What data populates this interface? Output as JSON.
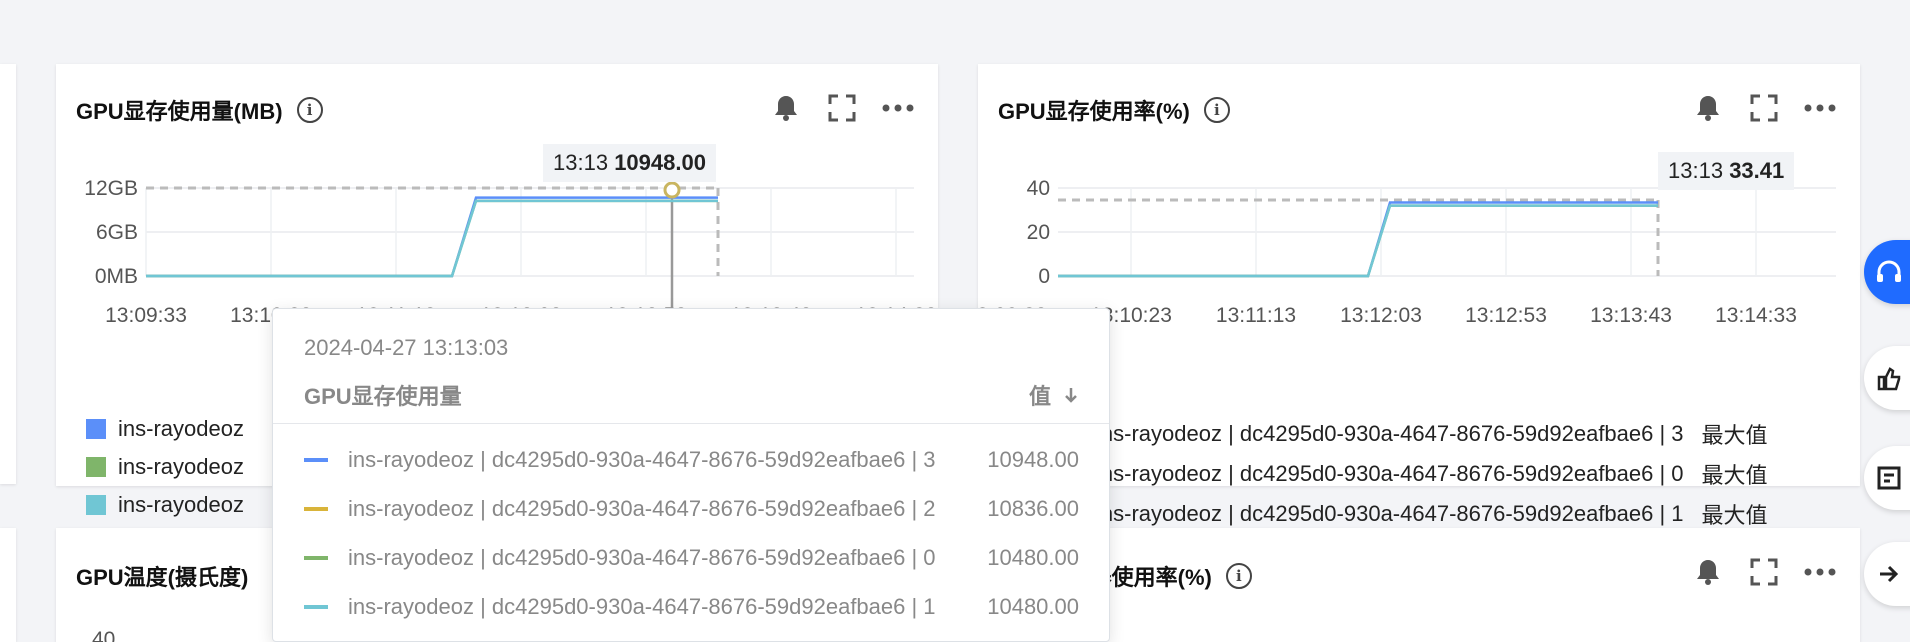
{
  "cards": {
    "memory_used": {
      "title": "GPU显存使用量(MB)",
      "y_ticks": [
        "12GB",
        "6GB",
        "0MB"
      ],
      "x_ticks": [
        "13:09:33",
        "13:10:23",
        "13:11:13",
        "13:12:03",
        "13:12:53",
        "13:13:43",
        "13:14:33"
      ],
      "point_label": {
        "time": "13:13",
        "value": "10948.00"
      },
      "legend": [
        "ins-rayodeoz",
        "ins-rayodeoz",
        "ins-rayodeoz"
      ]
    },
    "memory_rate": {
      "title": "GPU显存使用率(%)",
      "y_ticks": [
        "40",
        "20",
        "0"
      ],
      "x_ticks": [
        "13:09:33",
        "13:10:23",
        "13:11:13",
        "13:12:03",
        "13:12:53",
        "13:13:43",
        "13:14:33"
      ],
      "point_label": {
        "time": "13:13",
        "value": "33.41"
      },
      "legend": [
        {
          "text": "ins-rayodeoz | dc4295d0-930a-4647-8676-59d92eafbae6 | 3",
          "max": "最大值"
        },
        {
          "text": "ins-rayodeoz | dc4295d0-930a-4647-8676-59d92eafbae6 | 0",
          "max": "最大值"
        },
        {
          "text": "ins-rayodeoz | dc4295d0-930a-4647-8676-59d92eafbae6 | 1",
          "max": "最大值"
        }
      ]
    },
    "temperature": {
      "title": "GPU温度(摄氏度)",
      "y_tick": "40"
    },
    "encoder": {
      "title": "GPU编码器使用率(%)"
    }
  },
  "tooltip": {
    "date": "2024-04-27 13:13:03",
    "metric": "GPU显存使用量",
    "value_header": "值",
    "items": [
      {
        "name": "ins-rayodeoz | dc4295d0-930a-4647-8676-59d92eafbae6 | 3",
        "value": "10948.00",
        "color": "#5b8ff9"
      },
      {
        "name": "ins-rayodeoz | dc4295d0-930a-4647-8676-59d92eafbae6 | 2",
        "value": "10836.00",
        "color": "#d9b43a"
      },
      {
        "name": "ins-rayodeoz | dc4295d0-930a-4647-8676-59d92eafbae6 | 0",
        "value": "10480.00",
        "color": "#7fb56a"
      },
      {
        "name": "ins-rayodeoz | dc4295d0-930a-4647-8676-59d92eafbae6 | 1",
        "value": "10480.00",
        "color": "#70c6d4"
      }
    ]
  },
  "colors": {
    "series_blue": "#5b8ff9",
    "series_green": "#7fb56a",
    "series_cyan": "#70c6d4",
    "series_yellow": "#d9b43a",
    "accent": "#1f6bff"
  },
  "chart_data": [
    {
      "type": "line",
      "title": "GPU显存使用量(MB)",
      "x": [
        "13:09:33",
        "13:10:23",
        "13:11:13",
        "13:11:53",
        "13:12:03",
        "13:12:53",
        "13:13:03",
        "13:13:33"
      ],
      "series": [
        {
          "name": "ins-rayodeoz",
          "values": [
            0,
            0,
            0,
            0,
            10948,
            10948,
            10948,
            10948
          ]
        },
        {
          "name": "ins-rayodeoz",
          "values": [
            0,
            0,
            0,
            0,
            10480,
            10480,
            10480,
            10480
          ]
        },
        {
          "name": "ins-rayodeoz",
          "values": [
            0,
            0,
            0,
            0,
            10480,
            10480,
            10480,
            10480
          ]
        }
      ],
      "yticks": [
        "0MB",
        "6GB",
        "12GB"
      ]
    },
    {
      "type": "line",
      "title": "GPU显存使用率(%)",
      "x": [
        "13:09:33",
        "13:10:23",
        "13:11:13",
        "13:11:53",
        "13:12:03",
        "13:12:53",
        "13:13:43"
      ],
      "series": [
        {
          "name": "ins-rayodeoz | dc4295d0-930a-4647-8676-59d92eafbae6 | 3",
          "values": [
            0,
            0,
            0,
            0,
            33.4,
            33.4,
            33.4
          ]
        },
        {
          "name": "ins-rayodeoz | dc4295d0-930a-4647-8676-59d92eafbae6 | 0",
          "values": [
            0,
            0,
            0,
            0,
            32,
            32,
            32
          ]
        },
        {
          "name": "ins-rayodeoz | dc4295d0-930a-4647-8676-59d92eafbae6 | 1",
          "values": [
            0,
            0,
            0,
            0,
            32,
            32,
            32
          ]
        }
      ],
      "ylim": [
        0,
        40
      ],
      "yticks": [
        0,
        20,
        40
      ]
    }
  ]
}
